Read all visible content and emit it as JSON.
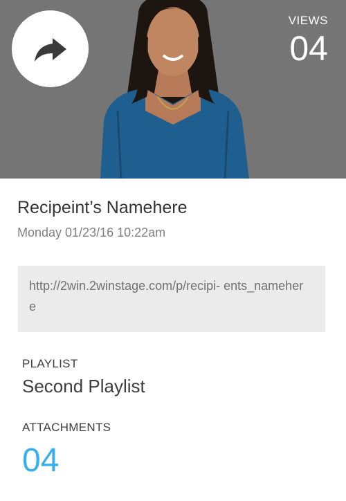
{
  "header": {
    "views_label": "VIEWS",
    "views_count": "04",
    "share_icon": "share-arrow-icon"
  },
  "recipient": {
    "name": "Recipeint’s Namehere",
    "timestamp": "Monday 01/23/16 10:22am"
  },
  "link": {
    "url": "http://2win.2winstage.com/p/recipi- ents_namehere"
  },
  "playlist": {
    "label": "PLAYLIST",
    "name": "Second Playlist"
  },
  "attachments": {
    "label": "ATTACHMENTS",
    "count": "04"
  },
  "colors": {
    "accent": "#35b0eb",
    "hero_overlay": "#6f6f6f",
    "url_box": "#ebebeb"
  }
}
